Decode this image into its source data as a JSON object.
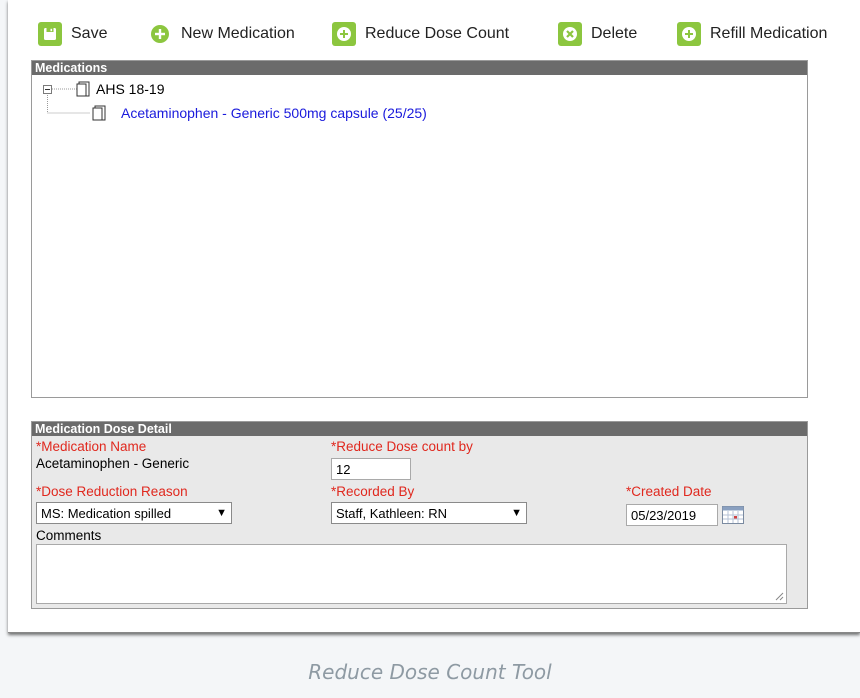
{
  "toolbar": {
    "save": "Save",
    "new_medication": "New Medication",
    "reduce_dose_count": "Reduce Dose Count",
    "delete": "Delete",
    "refill_medication": "Refill Medication"
  },
  "medications": {
    "header": "Medications",
    "root": "AHS 18-19",
    "child": "Acetaminophen - Generic 500mg capsule (25/25)"
  },
  "dose_detail": {
    "header": "Medication Dose Detail",
    "med_name_label": "*Medication Name",
    "med_name_value": "Acetaminophen - Generic",
    "reduce_by_label": "*Reduce Dose count by",
    "reduce_by_value": "12",
    "reason_label": "*Dose Reduction Reason",
    "reason_value": "MS: Medication spilled",
    "recorded_by_label": "*Recorded By",
    "recorded_by_value": "Staff, Kathleen: RN",
    "created_date_label": "*Created Date",
    "created_date_value": "05/23/2019",
    "comments_label": "Comments"
  },
  "caption": "Reduce Dose Count Tool",
  "colors": {
    "accent_green": "#8cc63f",
    "required_red": "#e0281e",
    "link_blue": "#1a1adc",
    "header_gray": "#6b6b6b"
  }
}
